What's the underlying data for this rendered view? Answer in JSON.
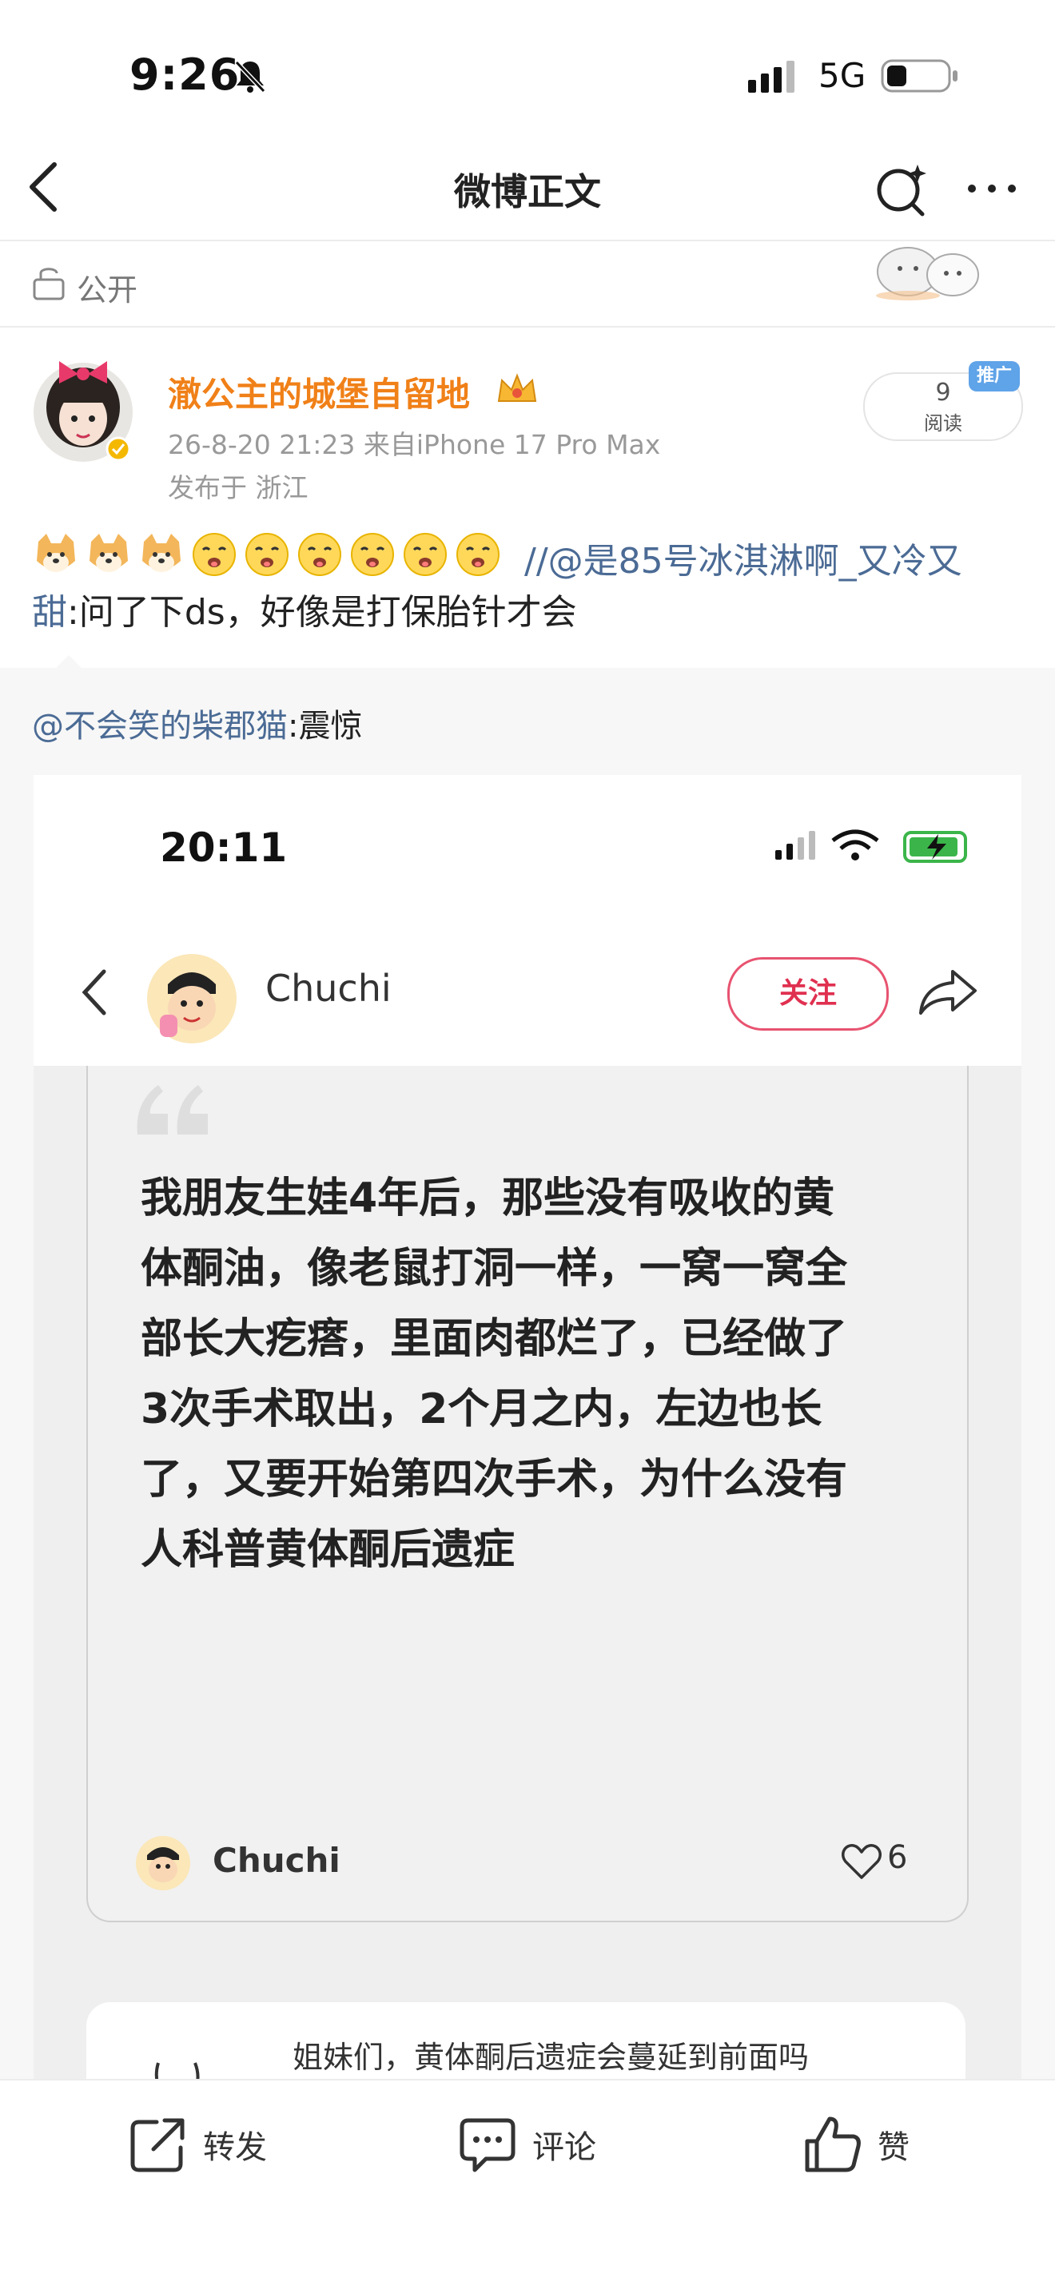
{
  "status_bar": {
    "time": "9:26",
    "network": "5G"
  },
  "nav": {
    "title": "微博正文"
  },
  "visibility": {
    "label": "公开"
  },
  "post": {
    "username": "澈公主的城堡自留地",
    "meta": "26-8-20 21:23  来自iPhone 17 Pro Max",
    "location": "发布于 浙江",
    "reads": {
      "count": "9",
      "label": "阅读",
      "badge": "推广"
    },
    "mention_1": "//@是85号冰淇淋啊_又冷又",
    "mention_1_tail": "甜",
    "body_text": ":问了下ds，好像是打保胎针才会"
  },
  "repost": {
    "mention": "@不会笑的柴郡猫",
    "text": ":震惊",
    "screenshot": {
      "time": "20:11",
      "username": "Chuchi",
      "follow_label": "关注",
      "quote_lines": [
        "我朋友生娃4年后，那些没有吸收的黄",
        "体酮油，像老鼠打洞一样，一窝一窝全",
        "部长大疙瘩，里面肉都烂了，已经做了",
        "3次手术取出，2个月之内，左边也长",
        "了，又要开始第四次手术，为什么没有",
        "人科普黄体酮后遗症"
      ],
      "footer_name": "Chuchi",
      "likes": "6",
      "card2_text": "姐妹们，黄体酮后遗症会蔓延到前面吗"
    }
  },
  "bottom_bar": {
    "repost": "转发",
    "comment": "评论",
    "like": "赞"
  }
}
